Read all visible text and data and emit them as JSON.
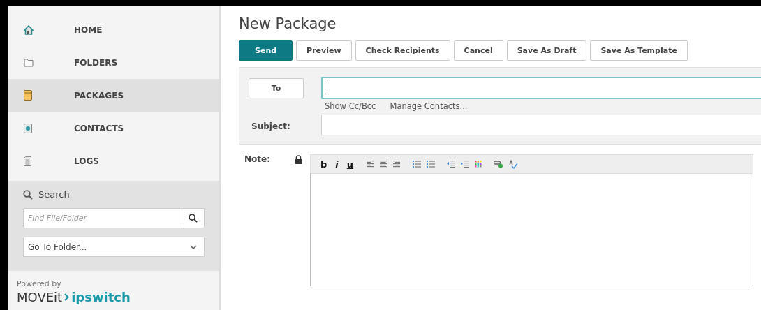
{
  "sidebar": {
    "items": [
      {
        "label": "HOME",
        "selected": false
      },
      {
        "label": "FOLDERS",
        "selected": false
      },
      {
        "label": "PACKAGES",
        "selected": true
      },
      {
        "label": "CONTACTS",
        "selected": false
      },
      {
        "label": "LOGS",
        "selected": false
      }
    ],
    "search": {
      "title": "Search",
      "placeholder": "Find File/Folder",
      "folder_select": "Go To Folder..."
    },
    "footer": {
      "powered_by": "Powered by",
      "product": "MOVEit",
      "company": "ipswitch"
    }
  },
  "page": {
    "title": "New Package",
    "buttons": [
      {
        "label": "Send",
        "primary": true
      },
      {
        "label": "Preview",
        "primary": false
      },
      {
        "label": "Check Recipients",
        "primary": false
      },
      {
        "label": "Cancel",
        "primary": false
      },
      {
        "label": "Save As Draft",
        "primary": false
      },
      {
        "label": "Save As Template",
        "primary": false
      }
    ],
    "to_button": "To",
    "links": [
      "Show Cc/Bcc",
      "Manage Contacts..."
    ],
    "subject_label": "Subject:",
    "note_label": "Note:",
    "format_buttons": [
      "b",
      "i",
      "u"
    ]
  }
}
